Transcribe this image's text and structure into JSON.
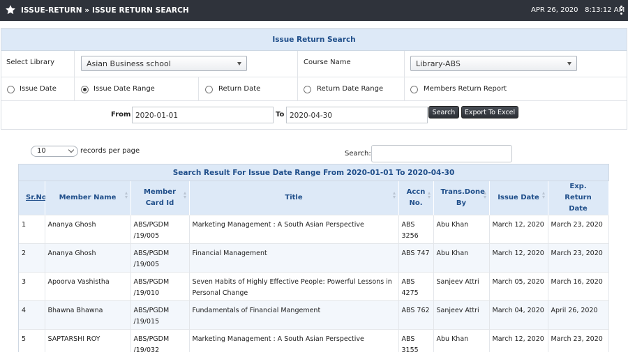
{
  "header": {
    "breadcrumb": "ISSUE-RETURN » ISSUE RETURN SEARCH",
    "date": "APR 26, 2020",
    "time": "8:13:12 AM"
  },
  "form": {
    "title": "Issue Return Search",
    "library_label": "Select Library",
    "library_value": "Asian Business school",
    "course_label": "Course Name",
    "course_value": "Library-ABS",
    "radios": [
      {
        "label": "Issue Date",
        "checked": false
      },
      {
        "label": "Issue Date Range",
        "checked": true
      },
      {
        "label": "Return Date",
        "checked": false
      },
      {
        "label": "Return Date Range",
        "checked": false
      },
      {
        "label": "Members Return Report",
        "checked": false
      }
    ],
    "from_label": "From",
    "from_value": "2020-01-01",
    "to_label": "To",
    "to_value": "2020-04-30",
    "search_button": "Search",
    "export_button": "Export To Excel"
  },
  "results": {
    "records_per_page_value": "10",
    "records_per_page_label": "records per page",
    "search_label": "Search:",
    "search_value": "",
    "title": "Search Result For Issue Date Range From 2020-01-01 To 2020-04-30",
    "columns": [
      "Sr.No",
      "Member Name",
      "Member Card Id",
      "Title",
      "Accn No.",
      "Trans.Done By",
      "Issue Date",
      "Exp. Return Date"
    ],
    "rows": [
      [
        "1",
        "Ananya Ghosh",
        "ABS/PGDM /19/005",
        "Marketing Management : A South Asian Perspective",
        "ABS 3256",
        "Abu Khan",
        "March 12, 2020",
        "March 23, 2020"
      ],
      [
        "2",
        "Ananya Ghosh",
        "ABS/PGDM /19/005",
        "Financial Management",
        "ABS 747",
        "Abu Khan",
        "March 12, 2020",
        "March 23, 2020"
      ],
      [
        "3",
        "Apoorva Vashistha",
        "ABS/PGDM /19/010",
        "Seven Habits of Highly Effective People: Powerful Lessons in Personal Change",
        "ABS 4275",
        "Sanjeev Attri",
        "March 05, 2020",
        "March 16, 2020"
      ],
      [
        "4",
        "Bhawna Bhawna",
        "ABS/PGDM /19/015",
        "Fundamentals of Financial Mangement",
        "ABS 762",
        "Sanjeev Attri",
        "March 04, 2020",
        "April 26, 2020"
      ],
      [
        "5",
        "SAPTARSHI ROY",
        "ABS/PGDM /19/032",
        "Marketing Management : A South Asian Perspective",
        "ABS 3155",
        "Abu Khan",
        "March 12, 2020",
        "March 23, 2020"
      ]
    ]
  }
}
